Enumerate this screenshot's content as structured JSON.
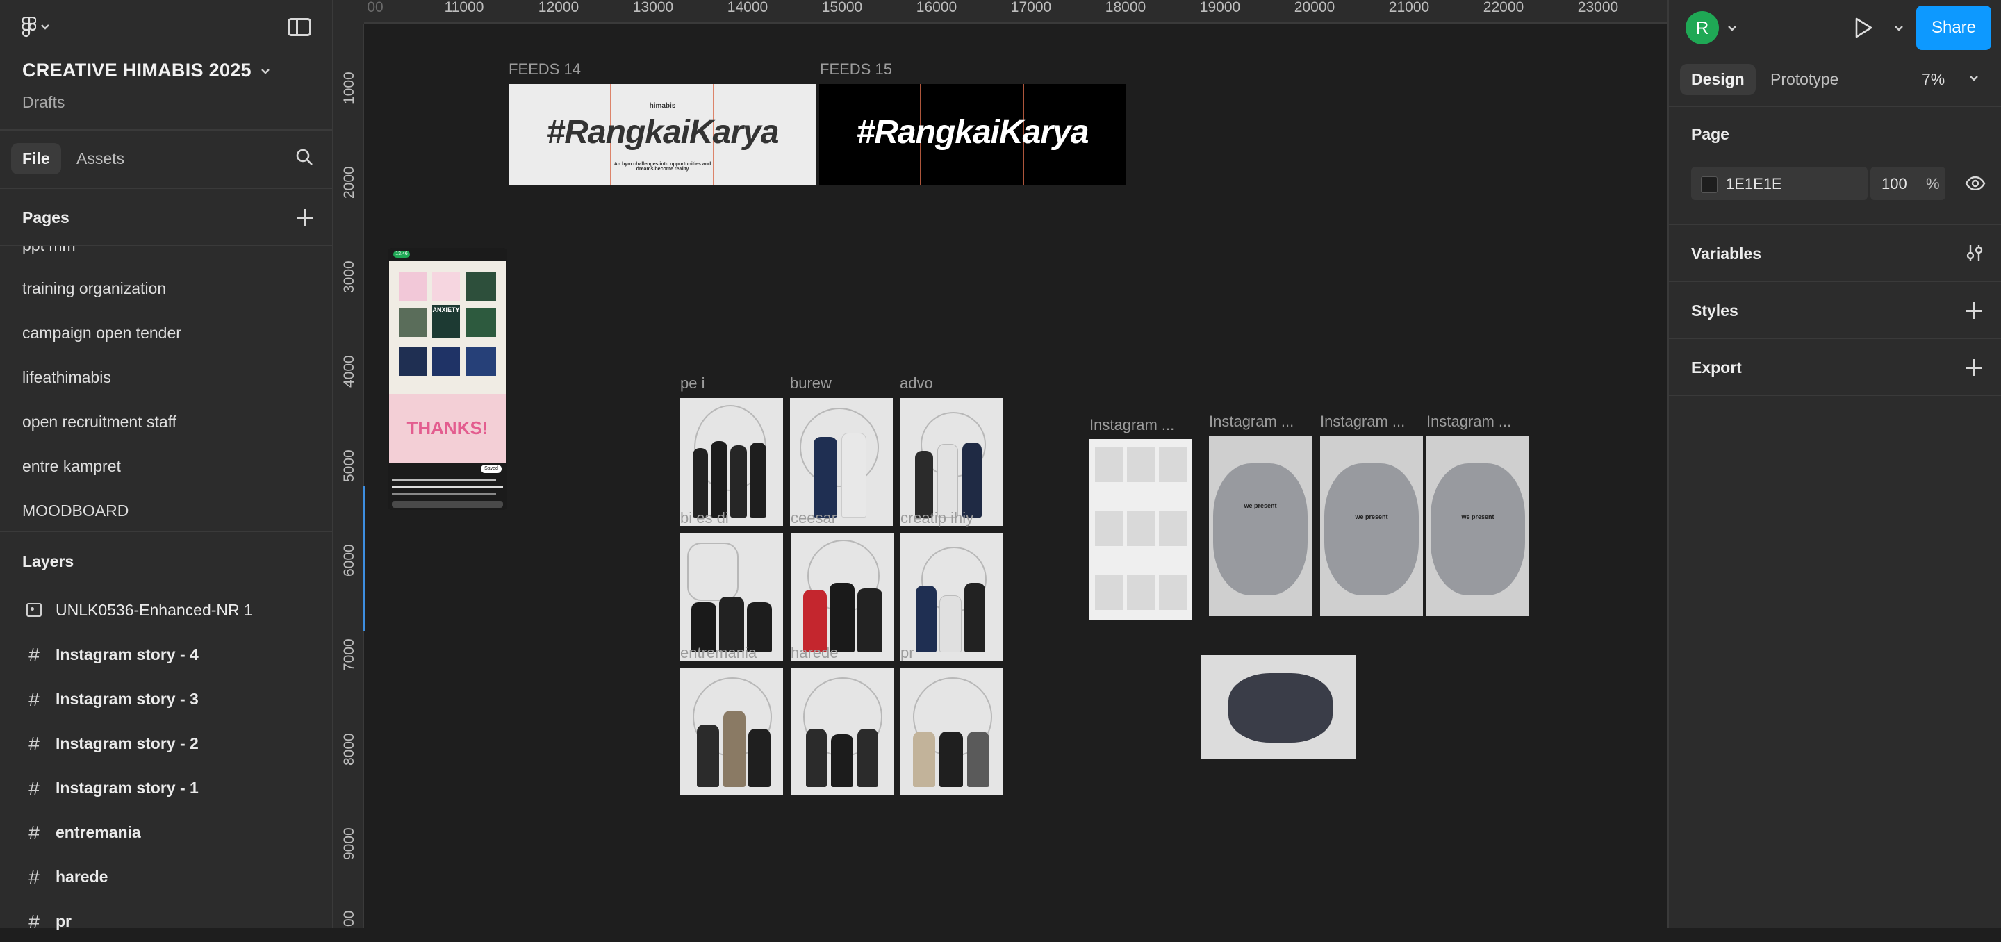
{
  "file": {
    "title": "CREATIVE HIMABIS 2025",
    "location": "Drafts"
  },
  "left_tabs": {
    "file": "File",
    "assets": "Assets"
  },
  "pages": {
    "title": "Pages",
    "items": [
      "ppt mm",
      "training organization",
      "campaign open tender",
      "lifeathimabis",
      "open recruitment staff",
      "entre kampret",
      "MOODBOARD"
    ]
  },
  "layers": {
    "title": "Layers",
    "items": [
      {
        "label": "UNLK0536-Enhanced-NR 1",
        "icon": "image-icon"
      },
      {
        "label": "Instagram story - 4",
        "icon": "frame-icon"
      },
      {
        "label": "Instagram story - 3",
        "icon": "frame-icon"
      },
      {
        "label": "Instagram story - 2",
        "icon": "frame-icon"
      },
      {
        "label": "Instagram story - 1",
        "icon": "frame-icon"
      },
      {
        "label": "entremania",
        "icon": "frame-icon"
      },
      {
        "label": "harede",
        "icon": "frame-icon"
      },
      {
        "label": "pr",
        "icon": "frame-icon"
      }
    ]
  },
  "ruler": {
    "top": [
      "00",
      "11000",
      "12000",
      "13000",
      "14000",
      "15000",
      "16000",
      "17000",
      "18000",
      "19000",
      "20000",
      "21000",
      "22000",
      "23000"
    ],
    "left": [
      "1000",
      "2000",
      "3000",
      "4000",
      "5000",
      "6000",
      "7000",
      "8000",
      "9000",
      "00"
    ]
  },
  "canvas": {
    "feeds": [
      {
        "label": "FEEDS 14",
        "tag": "#RangkaiKarya",
        "brand": "himabis",
        "caption": "An bym challenges into opportunities and dreams become reality"
      },
      {
        "label": "FEEDS 15",
        "tag": "#RangkaiKarya"
      }
    ],
    "divisions": [
      "pe i",
      "burew",
      "advo",
      "bi es di",
      "ceesar",
      "creatip ihiy",
      "entremania",
      "harede",
      "pr"
    ],
    "stories": [
      "Instagram ...",
      "Instagram ...",
      "Instagram ...",
      "Instagram ..."
    ],
    "phone": {
      "time": "13.46",
      "thanks_text": "THANKS!",
      "save_label": "Saved",
      "poster_title": "ANXIETY"
    },
    "story_overlay": "we present"
  },
  "right_panel": {
    "avatar_initial": "R",
    "share_label": "Share",
    "tabs": {
      "design": "Design",
      "prototype": "Prototype"
    },
    "zoom": "7%",
    "page": {
      "title": "Page",
      "fill_hex": "1E1E1E",
      "opacity": "100",
      "opacity_unit": "%"
    },
    "sections": [
      "Variables",
      "Styles",
      "Export"
    ]
  },
  "colors": {
    "accent": "#0d99ff",
    "avatar": "#1fa855",
    "canvas_bg": "#1e1e1e",
    "panel_bg": "#2c2c2c"
  }
}
